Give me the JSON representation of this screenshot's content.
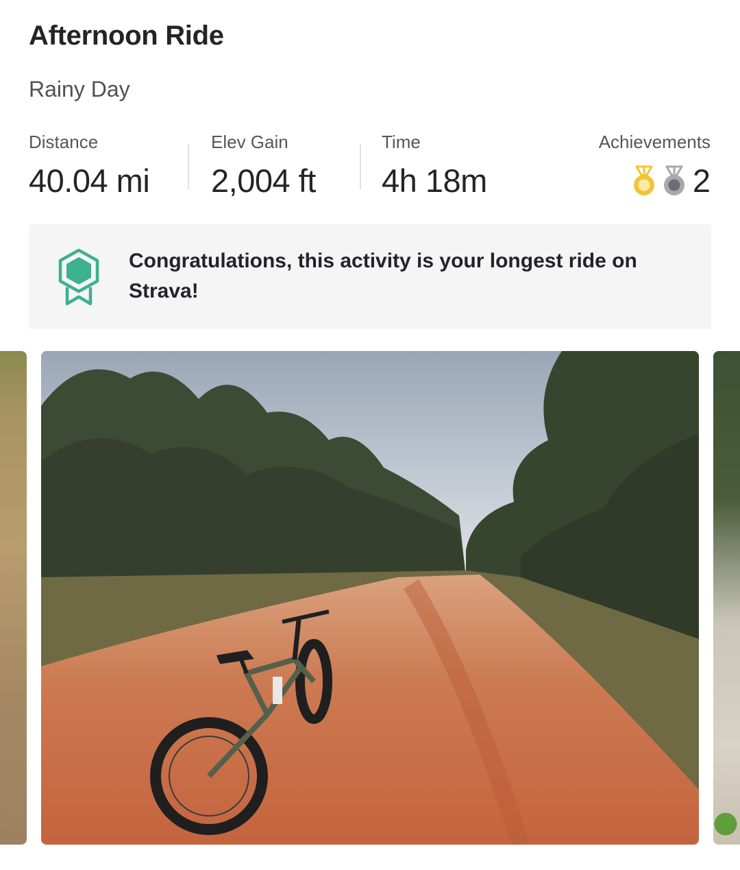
{
  "activity": {
    "title": "Afternoon Ride",
    "description": "Rainy Day"
  },
  "stats": {
    "distance": {
      "label": "Distance",
      "value": "40.04 mi"
    },
    "elev_gain": {
      "label": "Elev Gain",
      "value": "2,004 ft"
    },
    "time": {
      "label": "Time",
      "value": "4h 18m"
    },
    "achievements": {
      "label": "Achievements",
      "count": "2",
      "medals": [
        "gold-medal-icon",
        "silver-medal-icon"
      ]
    }
  },
  "banner": {
    "icon": "achievement-badge-icon",
    "text": "Congratulations, this activity is your longest ride on Strava!"
  },
  "colors": {
    "gold": "#f2c438",
    "silver": "#a8a8ad",
    "badge_green": "#3cb18c",
    "banner_bg": "#f5f5f5"
  }
}
